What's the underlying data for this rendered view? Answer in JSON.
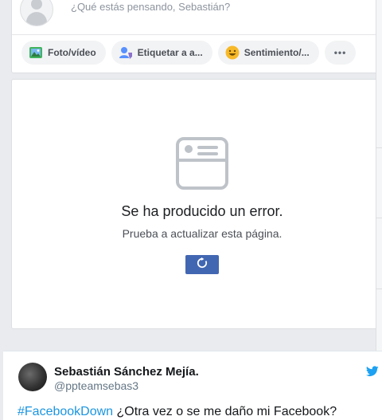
{
  "composer": {
    "placeholder": "¿Qué estás pensando, Sebastián?",
    "actions": [
      {
        "label": "Foto/vídeo",
        "icon": "photo-icon"
      },
      {
        "label": "Etiquetar a a...",
        "icon": "tag-friends-icon"
      },
      {
        "label": "Sentimiento/...",
        "icon": "feeling-icon"
      },
      {
        "label": "•••",
        "icon": "more-icon"
      }
    ]
  },
  "error": {
    "title": "Se ha producido un error.",
    "subtitle": "Prueba a actualizar esta página."
  },
  "tweet": {
    "name": "Sebastián Sánchez Mejía.",
    "handle": "@ppteamsebas3",
    "hashtag": "#FacebookDown",
    "text": " ¿Otra vez o se me daño mi Facebook?"
  },
  "colors": {
    "accent": "#4267b2",
    "twitter": "#1da1f2",
    "hashtag": "#1b95e0"
  }
}
